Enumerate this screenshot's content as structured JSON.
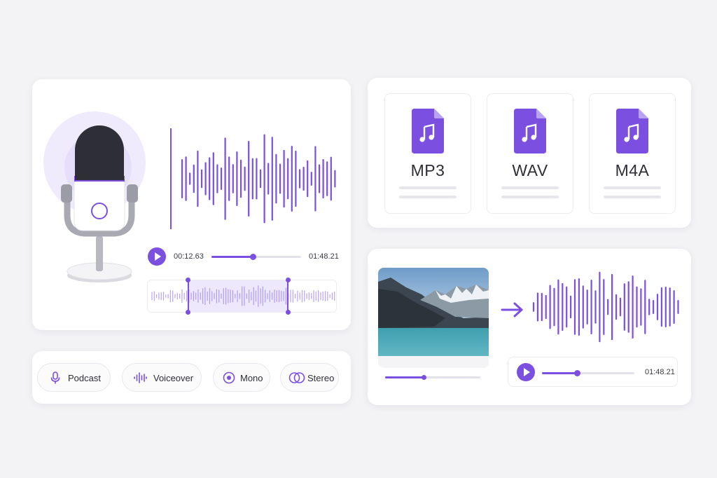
{
  "colors": {
    "accent": "#7b4fe0",
    "accent_light": "#e6dffb",
    "bg": "#f3f3f5"
  },
  "recorder": {
    "icon": "microphone-icon",
    "current_time": "00:12.63",
    "total_time": "01:48.21",
    "progress": 0.46,
    "selection_start": 0.21,
    "selection_end": 0.74
  },
  "formats": [
    {
      "label": "MP3",
      "icon": "music-file-icon"
    },
    {
      "label": "WAV",
      "icon": "music-file-icon"
    },
    {
      "label": "M4A",
      "icon": "music-file-icon"
    }
  ],
  "converter": {
    "video_progress": 0.41,
    "arrow_icon": "arrow-right-icon",
    "total_time": "01:48.21",
    "progress": 0.38
  },
  "modes": [
    {
      "label": "Podcast",
      "icon": "microphone-icon"
    },
    {
      "label": "Voiceover",
      "icon": "waveform-icon"
    },
    {
      "label": "Mono",
      "icon": "mono-icon"
    },
    {
      "label": "Stereo",
      "icon": "stereo-icon"
    }
  ]
}
